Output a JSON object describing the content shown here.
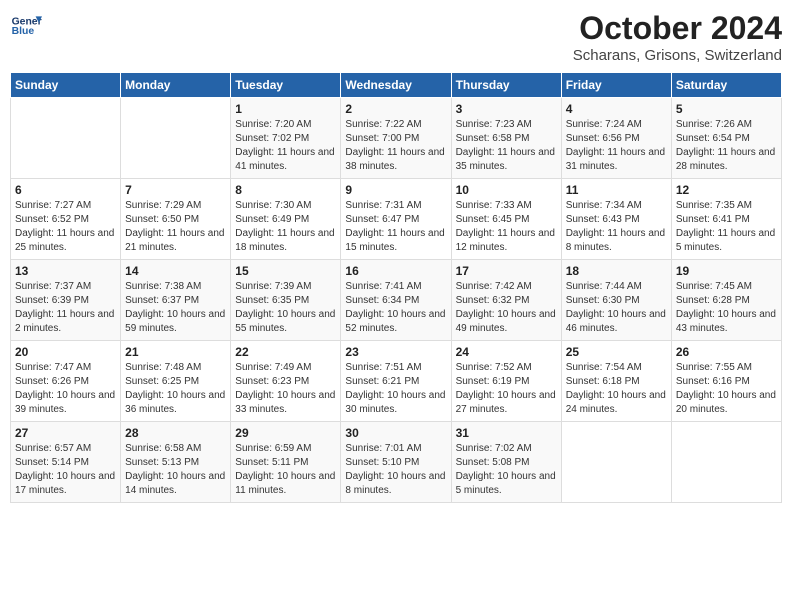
{
  "header": {
    "logo_line1": "General",
    "logo_line2": "Blue",
    "month": "October 2024",
    "location": "Scharans, Grisons, Switzerland"
  },
  "weekdays": [
    "Sunday",
    "Monday",
    "Tuesday",
    "Wednesday",
    "Thursday",
    "Friday",
    "Saturday"
  ],
  "weeks": [
    [
      {
        "day": "",
        "info": ""
      },
      {
        "day": "",
        "info": ""
      },
      {
        "day": "1",
        "info": "Sunrise: 7:20 AM\nSunset: 7:02 PM\nDaylight: 11 hours and 41 minutes."
      },
      {
        "day": "2",
        "info": "Sunrise: 7:22 AM\nSunset: 7:00 PM\nDaylight: 11 hours and 38 minutes."
      },
      {
        "day": "3",
        "info": "Sunrise: 7:23 AM\nSunset: 6:58 PM\nDaylight: 11 hours and 35 minutes."
      },
      {
        "day": "4",
        "info": "Sunrise: 7:24 AM\nSunset: 6:56 PM\nDaylight: 11 hours and 31 minutes."
      },
      {
        "day": "5",
        "info": "Sunrise: 7:26 AM\nSunset: 6:54 PM\nDaylight: 11 hours and 28 minutes."
      }
    ],
    [
      {
        "day": "6",
        "info": "Sunrise: 7:27 AM\nSunset: 6:52 PM\nDaylight: 11 hours and 25 minutes."
      },
      {
        "day": "7",
        "info": "Sunrise: 7:29 AM\nSunset: 6:50 PM\nDaylight: 11 hours and 21 minutes."
      },
      {
        "day": "8",
        "info": "Sunrise: 7:30 AM\nSunset: 6:49 PM\nDaylight: 11 hours and 18 minutes."
      },
      {
        "day": "9",
        "info": "Sunrise: 7:31 AM\nSunset: 6:47 PM\nDaylight: 11 hours and 15 minutes."
      },
      {
        "day": "10",
        "info": "Sunrise: 7:33 AM\nSunset: 6:45 PM\nDaylight: 11 hours and 12 minutes."
      },
      {
        "day": "11",
        "info": "Sunrise: 7:34 AM\nSunset: 6:43 PM\nDaylight: 11 hours and 8 minutes."
      },
      {
        "day": "12",
        "info": "Sunrise: 7:35 AM\nSunset: 6:41 PM\nDaylight: 11 hours and 5 minutes."
      }
    ],
    [
      {
        "day": "13",
        "info": "Sunrise: 7:37 AM\nSunset: 6:39 PM\nDaylight: 11 hours and 2 minutes."
      },
      {
        "day": "14",
        "info": "Sunrise: 7:38 AM\nSunset: 6:37 PM\nDaylight: 10 hours and 59 minutes."
      },
      {
        "day": "15",
        "info": "Sunrise: 7:39 AM\nSunset: 6:35 PM\nDaylight: 10 hours and 55 minutes."
      },
      {
        "day": "16",
        "info": "Sunrise: 7:41 AM\nSunset: 6:34 PM\nDaylight: 10 hours and 52 minutes."
      },
      {
        "day": "17",
        "info": "Sunrise: 7:42 AM\nSunset: 6:32 PM\nDaylight: 10 hours and 49 minutes."
      },
      {
        "day": "18",
        "info": "Sunrise: 7:44 AM\nSunset: 6:30 PM\nDaylight: 10 hours and 46 minutes."
      },
      {
        "day": "19",
        "info": "Sunrise: 7:45 AM\nSunset: 6:28 PM\nDaylight: 10 hours and 43 minutes."
      }
    ],
    [
      {
        "day": "20",
        "info": "Sunrise: 7:47 AM\nSunset: 6:26 PM\nDaylight: 10 hours and 39 minutes."
      },
      {
        "day": "21",
        "info": "Sunrise: 7:48 AM\nSunset: 6:25 PM\nDaylight: 10 hours and 36 minutes."
      },
      {
        "day": "22",
        "info": "Sunrise: 7:49 AM\nSunset: 6:23 PM\nDaylight: 10 hours and 33 minutes."
      },
      {
        "day": "23",
        "info": "Sunrise: 7:51 AM\nSunset: 6:21 PM\nDaylight: 10 hours and 30 minutes."
      },
      {
        "day": "24",
        "info": "Sunrise: 7:52 AM\nSunset: 6:19 PM\nDaylight: 10 hours and 27 minutes."
      },
      {
        "day": "25",
        "info": "Sunrise: 7:54 AM\nSunset: 6:18 PM\nDaylight: 10 hours and 24 minutes."
      },
      {
        "day": "26",
        "info": "Sunrise: 7:55 AM\nSunset: 6:16 PM\nDaylight: 10 hours and 20 minutes."
      }
    ],
    [
      {
        "day": "27",
        "info": "Sunrise: 6:57 AM\nSunset: 5:14 PM\nDaylight: 10 hours and 17 minutes."
      },
      {
        "day": "28",
        "info": "Sunrise: 6:58 AM\nSunset: 5:13 PM\nDaylight: 10 hours and 14 minutes."
      },
      {
        "day": "29",
        "info": "Sunrise: 6:59 AM\nSunset: 5:11 PM\nDaylight: 10 hours and 11 minutes."
      },
      {
        "day": "30",
        "info": "Sunrise: 7:01 AM\nSunset: 5:10 PM\nDaylight: 10 hours and 8 minutes."
      },
      {
        "day": "31",
        "info": "Sunrise: 7:02 AM\nSunset: 5:08 PM\nDaylight: 10 hours and 5 minutes."
      },
      {
        "day": "",
        "info": ""
      },
      {
        "day": "",
        "info": ""
      }
    ]
  ]
}
